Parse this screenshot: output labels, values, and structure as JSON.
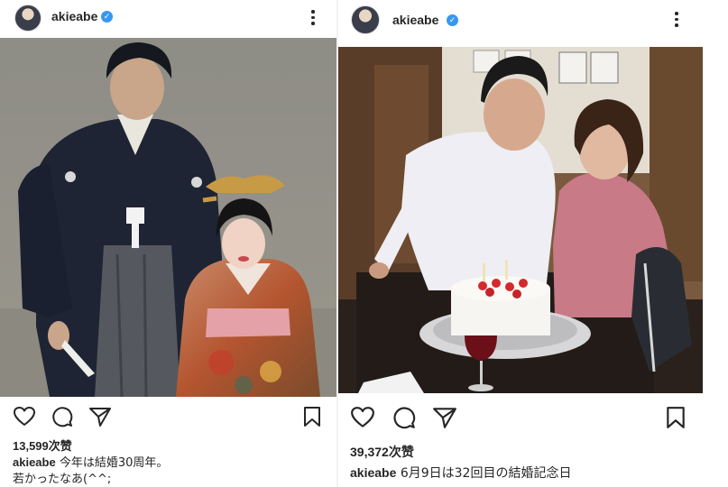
{
  "posts": [
    {
      "username": "akieabe",
      "verified_icon": "verified-badge-icon",
      "likes": "13,599次赞",
      "caption_user": "akieabe",
      "caption_text": " 今年は結婚30周年。",
      "caption_more": "若かったなあ(^^;",
      "icons": [
        "heart-icon",
        "comment-icon",
        "share-icon",
        "bookmark-icon",
        "more-options-icon"
      ]
    },
    {
      "username": "akieabe",
      "verified_icon": "verified-badge-icon",
      "likes": "39,372次赞",
      "caption_user": "akieabe",
      "caption_text": " 6月9日は32回目の結婚記念日",
      "icons": [
        "heart-icon",
        "comment-icon",
        "share-icon",
        "bookmark-icon",
        "more-options-icon"
      ]
    }
  ],
  "colors": {
    "verified": "#3897f0",
    "text": "#262626",
    "background": "#ffffff"
  }
}
